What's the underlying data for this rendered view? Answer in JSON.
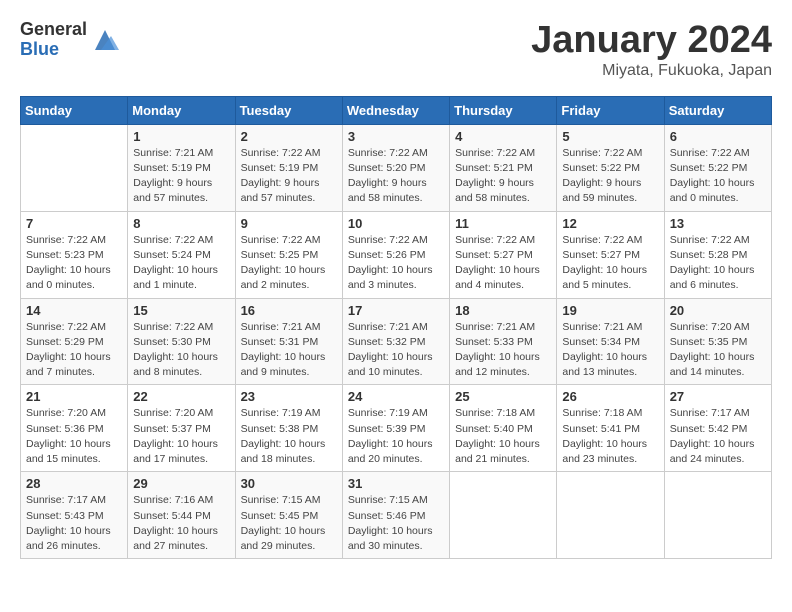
{
  "header": {
    "logo_general": "General",
    "logo_blue": "Blue",
    "month_title": "January 2024",
    "location": "Miyata, Fukuoka, Japan"
  },
  "weekdays": [
    "Sunday",
    "Monday",
    "Tuesday",
    "Wednesday",
    "Thursday",
    "Friday",
    "Saturday"
  ],
  "weeks": [
    [
      {
        "day": "",
        "info": ""
      },
      {
        "day": "1",
        "info": "Sunrise: 7:21 AM\nSunset: 5:19 PM\nDaylight: 9 hours\nand 57 minutes."
      },
      {
        "day": "2",
        "info": "Sunrise: 7:22 AM\nSunset: 5:19 PM\nDaylight: 9 hours\nand 57 minutes."
      },
      {
        "day": "3",
        "info": "Sunrise: 7:22 AM\nSunset: 5:20 PM\nDaylight: 9 hours\nand 58 minutes."
      },
      {
        "day": "4",
        "info": "Sunrise: 7:22 AM\nSunset: 5:21 PM\nDaylight: 9 hours\nand 58 minutes."
      },
      {
        "day": "5",
        "info": "Sunrise: 7:22 AM\nSunset: 5:22 PM\nDaylight: 9 hours\nand 59 minutes."
      },
      {
        "day": "6",
        "info": "Sunrise: 7:22 AM\nSunset: 5:22 PM\nDaylight: 10 hours\nand 0 minutes."
      }
    ],
    [
      {
        "day": "7",
        "info": "Sunrise: 7:22 AM\nSunset: 5:23 PM\nDaylight: 10 hours\nand 0 minutes."
      },
      {
        "day": "8",
        "info": "Sunrise: 7:22 AM\nSunset: 5:24 PM\nDaylight: 10 hours\nand 1 minute."
      },
      {
        "day": "9",
        "info": "Sunrise: 7:22 AM\nSunset: 5:25 PM\nDaylight: 10 hours\nand 2 minutes."
      },
      {
        "day": "10",
        "info": "Sunrise: 7:22 AM\nSunset: 5:26 PM\nDaylight: 10 hours\nand 3 minutes."
      },
      {
        "day": "11",
        "info": "Sunrise: 7:22 AM\nSunset: 5:27 PM\nDaylight: 10 hours\nand 4 minutes."
      },
      {
        "day": "12",
        "info": "Sunrise: 7:22 AM\nSunset: 5:27 PM\nDaylight: 10 hours\nand 5 minutes."
      },
      {
        "day": "13",
        "info": "Sunrise: 7:22 AM\nSunset: 5:28 PM\nDaylight: 10 hours\nand 6 minutes."
      }
    ],
    [
      {
        "day": "14",
        "info": "Sunrise: 7:22 AM\nSunset: 5:29 PM\nDaylight: 10 hours\nand 7 minutes."
      },
      {
        "day": "15",
        "info": "Sunrise: 7:22 AM\nSunset: 5:30 PM\nDaylight: 10 hours\nand 8 minutes."
      },
      {
        "day": "16",
        "info": "Sunrise: 7:21 AM\nSunset: 5:31 PM\nDaylight: 10 hours\nand 9 minutes."
      },
      {
        "day": "17",
        "info": "Sunrise: 7:21 AM\nSunset: 5:32 PM\nDaylight: 10 hours\nand 10 minutes."
      },
      {
        "day": "18",
        "info": "Sunrise: 7:21 AM\nSunset: 5:33 PM\nDaylight: 10 hours\nand 12 minutes."
      },
      {
        "day": "19",
        "info": "Sunrise: 7:21 AM\nSunset: 5:34 PM\nDaylight: 10 hours\nand 13 minutes."
      },
      {
        "day": "20",
        "info": "Sunrise: 7:20 AM\nSunset: 5:35 PM\nDaylight: 10 hours\nand 14 minutes."
      }
    ],
    [
      {
        "day": "21",
        "info": "Sunrise: 7:20 AM\nSunset: 5:36 PM\nDaylight: 10 hours\nand 15 minutes."
      },
      {
        "day": "22",
        "info": "Sunrise: 7:20 AM\nSunset: 5:37 PM\nDaylight: 10 hours\nand 17 minutes."
      },
      {
        "day": "23",
        "info": "Sunrise: 7:19 AM\nSunset: 5:38 PM\nDaylight: 10 hours\nand 18 minutes."
      },
      {
        "day": "24",
        "info": "Sunrise: 7:19 AM\nSunset: 5:39 PM\nDaylight: 10 hours\nand 20 minutes."
      },
      {
        "day": "25",
        "info": "Sunrise: 7:18 AM\nSunset: 5:40 PM\nDaylight: 10 hours\nand 21 minutes."
      },
      {
        "day": "26",
        "info": "Sunrise: 7:18 AM\nSunset: 5:41 PM\nDaylight: 10 hours\nand 23 minutes."
      },
      {
        "day": "27",
        "info": "Sunrise: 7:17 AM\nSunset: 5:42 PM\nDaylight: 10 hours\nand 24 minutes."
      }
    ],
    [
      {
        "day": "28",
        "info": "Sunrise: 7:17 AM\nSunset: 5:43 PM\nDaylight: 10 hours\nand 26 minutes."
      },
      {
        "day": "29",
        "info": "Sunrise: 7:16 AM\nSunset: 5:44 PM\nDaylight: 10 hours\nand 27 minutes."
      },
      {
        "day": "30",
        "info": "Sunrise: 7:15 AM\nSunset: 5:45 PM\nDaylight: 10 hours\nand 29 minutes."
      },
      {
        "day": "31",
        "info": "Sunrise: 7:15 AM\nSunset: 5:46 PM\nDaylight: 10 hours\nand 30 minutes."
      },
      {
        "day": "",
        "info": ""
      },
      {
        "day": "",
        "info": ""
      },
      {
        "day": "",
        "info": ""
      }
    ]
  ]
}
